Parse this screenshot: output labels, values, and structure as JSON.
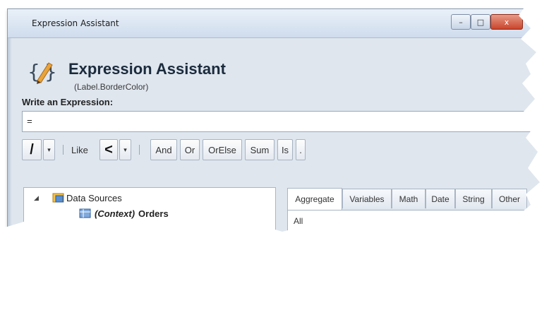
{
  "window": {
    "title": "Expression Assistant",
    "controls": {
      "minimize": "–",
      "maximize": "□",
      "close": "x"
    }
  },
  "header": {
    "title": "Expression Assistant",
    "subtitle": "(Label.BorderColor)",
    "icon": "curly-brace-pencil-icon"
  },
  "expression": {
    "label": "Write an Expression:",
    "value": "="
  },
  "toolbar": {
    "divide": "/",
    "dropdown_arrow": "▾",
    "like": "Like",
    "less_than": "<",
    "buttons": [
      "And",
      "Or",
      "OrElse",
      "Sum",
      "Is",
      "."
    ]
  },
  "tree": {
    "root": {
      "expander": "◢",
      "label": "Data Sources"
    },
    "child": {
      "prefix": "(Context)",
      "label": "Orders"
    }
  },
  "tabs": {
    "items": [
      "Aggregate",
      "Variables",
      "Math",
      "Date",
      "String",
      "Other"
    ],
    "active": "Aggregate",
    "list_first": "All"
  },
  "colors": {
    "window_bg": "#dfe6ee",
    "title_gradient_top": "#e9f0f8",
    "close_button": "#c9452c",
    "icon_orange": "#e8a33a"
  }
}
